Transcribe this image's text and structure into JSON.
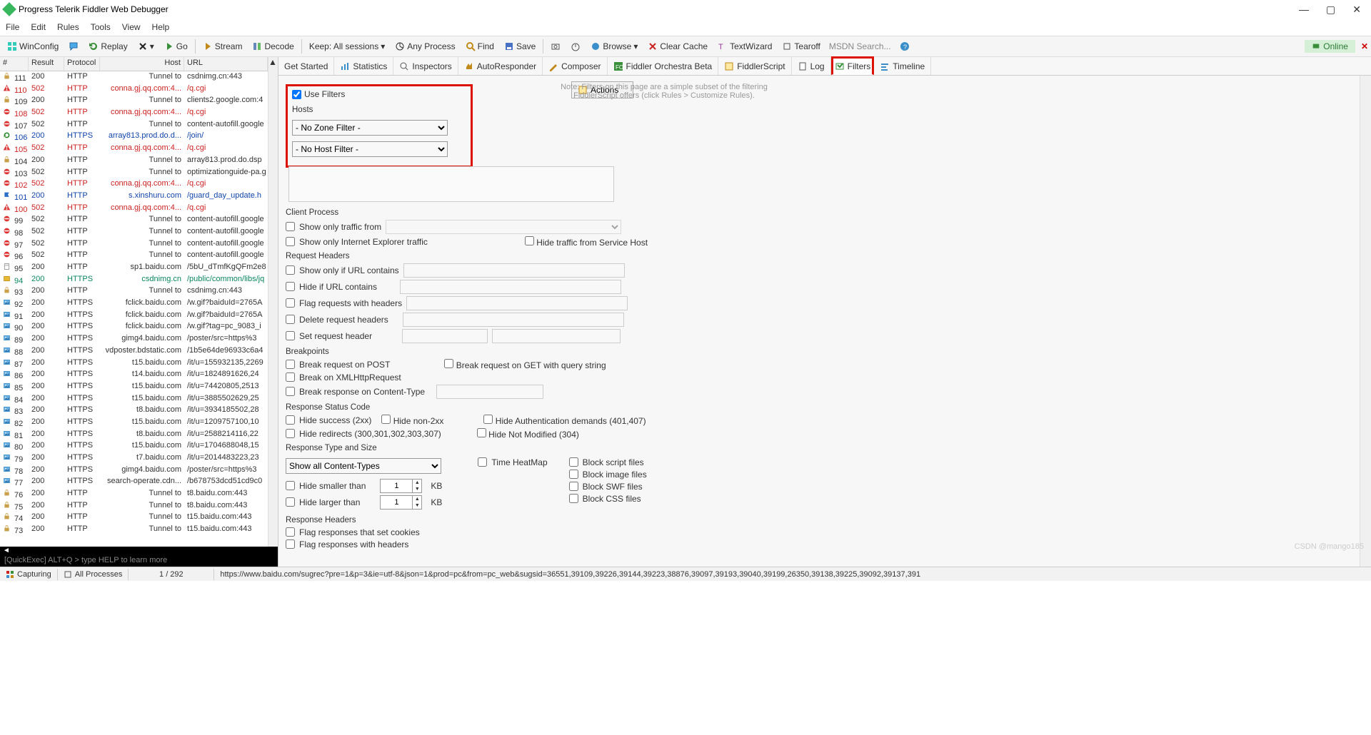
{
  "titlebar": {
    "title": "Progress Telerik Fiddler Web Debugger"
  },
  "menubar": {
    "items": [
      "File",
      "Edit",
      "Rules",
      "Tools",
      "View",
      "Help"
    ]
  },
  "toolbar": {
    "winconfig": "WinConfig",
    "replay": "Replay",
    "go": "Go",
    "stream": "Stream",
    "decode": "Decode",
    "keep": "Keep: All sessions",
    "anyprocess": "Any Process",
    "find": "Find",
    "save": "Save",
    "browse": "Browse",
    "clear": "Clear Cache",
    "textwizard": "TextWizard",
    "tearoff": "Tearoff",
    "search_placeholder": "MSDN Search...",
    "online": "Online"
  },
  "left": {
    "headers": {
      "num": "#",
      "result": "Result",
      "protocol": "Protocol",
      "host": "Host",
      "url": "URL"
    },
    "quickexec": "[QuickExec] ALT+Q > type HELP to learn more",
    "rows": [
      {
        "n": "111",
        "r": "200",
        "p": "HTTP",
        "h": "Tunnel to",
        "u": "csdnimg.cn:443",
        "cls": "row-black",
        "ico": "lock"
      },
      {
        "n": "110",
        "r": "502",
        "p": "HTTP",
        "h": "conna.gj.qq.com:4...",
        "u": "/q.cgi",
        "cls": "row-red",
        "ico": "warn"
      },
      {
        "n": "109",
        "r": "200",
        "p": "HTTP",
        "h": "Tunnel to",
        "u": "clients2.google.com:4",
        "cls": "row-black",
        "ico": "lock"
      },
      {
        "n": "108",
        "r": "502",
        "p": "HTTP",
        "h": "conna.gj.qq.com:4...",
        "u": "/q.cgi",
        "cls": "row-red",
        "ico": "block"
      },
      {
        "n": "107",
        "r": "502",
        "p": "HTTP",
        "h": "Tunnel to",
        "u": "content-autofill.google",
        "cls": "row-black",
        "ico": "block"
      },
      {
        "n": "106",
        "r": "200",
        "p": "HTTPS",
        "h": "array813.prod.do.d...",
        "u": "/join/",
        "cls": "row-blue",
        "ico": "refresh"
      },
      {
        "n": "105",
        "r": "502",
        "p": "HTTP",
        "h": "conna.gj.qq.com:4...",
        "u": "/q.cgi",
        "cls": "row-red",
        "ico": "warn"
      },
      {
        "n": "104",
        "r": "200",
        "p": "HTTP",
        "h": "Tunnel to",
        "u": "array813.prod.do.dsp",
        "cls": "row-black",
        "ico": "lock"
      },
      {
        "n": "103",
        "r": "502",
        "p": "HTTP",
        "h": "Tunnel to",
        "u": "optimizationguide-pa.g",
        "cls": "row-black",
        "ico": "block"
      },
      {
        "n": "102",
        "r": "502",
        "p": "HTTP",
        "h": "conna.gj.qq.com:4...",
        "u": "/q.cgi",
        "cls": "row-red",
        "ico": "block"
      },
      {
        "n": "101",
        "r": "200",
        "p": "HTTP",
        "h": "s.xinshuru.com",
        "u": "/guard_day_update.h",
        "cls": "row-blue",
        "ico": "blue"
      },
      {
        "n": "100",
        "r": "502",
        "p": "HTTP",
        "h": "conna.gj.qq.com:4...",
        "u": "/q.cgi",
        "cls": "row-red",
        "ico": "warn"
      },
      {
        "n": "99",
        "r": "502",
        "p": "HTTP",
        "h": "Tunnel to",
        "u": "content-autofill.google",
        "cls": "row-black",
        "ico": "block"
      },
      {
        "n": "98",
        "r": "502",
        "p": "HTTP",
        "h": "Tunnel to",
        "u": "content-autofill.google",
        "cls": "row-black",
        "ico": "block"
      },
      {
        "n": "97",
        "r": "502",
        "p": "HTTP",
        "h": "Tunnel to",
        "u": "content-autofill.google",
        "cls": "row-black",
        "ico": "block"
      },
      {
        "n": "96",
        "r": "502",
        "p": "HTTP",
        "h": "Tunnel to",
        "u": "content-autofill.google",
        "cls": "row-black",
        "ico": "block"
      },
      {
        "n": "95",
        "r": "200",
        "p": "HTTP",
        "h": "sp1.baidu.com",
        "u": "/5bU_dTmfKgQFm2e8",
        "cls": "row-black",
        "ico": "page"
      },
      {
        "n": "94",
        "r": "200",
        "p": "HTTPS",
        "h": "csdnimg.cn",
        "u": "/public/common/libs/jq",
        "cls": "row-teal",
        "ico": "green"
      },
      {
        "n": "93",
        "r": "200",
        "p": "HTTP",
        "h": "Tunnel to",
        "u": "csdnimg.cn:443",
        "cls": "row-black",
        "ico": "lock"
      },
      {
        "n": "92",
        "r": "200",
        "p": "HTTPS",
        "h": "fclick.baidu.com",
        "u": "/w.gif?baiduId=2765A",
        "cls": "row-black",
        "ico": "img"
      },
      {
        "n": "91",
        "r": "200",
        "p": "HTTPS",
        "h": "fclick.baidu.com",
        "u": "/w.gif?baiduId=2765A",
        "cls": "row-black",
        "ico": "img"
      },
      {
        "n": "90",
        "r": "200",
        "p": "HTTPS",
        "h": "fclick.baidu.com",
        "u": "/w.gif?tag=pc_9083_i",
        "cls": "row-black",
        "ico": "img"
      },
      {
        "n": "89",
        "r": "200",
        "p": "HTTPS",
        "h": "gimg4.baidu.com",
        "u": "/poster/src=https%3",
        "cls": "row-black",
        "ico": "img"
      },
      {
        "n": "88",
        "r": "200",
        "p": "HTTPS",
        "h": "vdposter.bdstatic.com",
        "u": "/1b5e64de96933c6a4",
        "cls": "row-black",
        "ico": "img"
      },
      {
        "n": "87",
        "r": "200",
        "p": "HTTPS",
        "h": "t15.baidu.com",
        "u": "/it/u=155932135,2269",
        "cls": "row-black",
        "ico": "img"
      },
      {
        "n": "86",
        "r": "200",
        "p": "HTTPS",
        "h": "t14.baidu.com",
        "u": "/it/u=1824891626,24",
        "cls": "row-black",
        "ico": "img"
      },
      {
        "n": "85",
        "r": "200",
        "p": "HTTPS",
        "h": "t15.baidu.com",
        "u": "/it/u=74420805,2513",
        "cls": "row-black",
        "ico": "img"
      },
      {
        "n": "84",
        "r": "200",
        "p": "HTTPS",
        "h": "t15.baidu.com",
        "u": "/it/u=3885502629,25",
        "cls": "row-black",
        "ico": "img"
      },
      {
        "n": "83",
        "r": "200",
        "p": "HTTPS",
        "h": "t8.baidu.com",
        "u": "/it/u=3934185502,28",
        "cls": "row-black",
        "ico": "img"
      },
      {
        "n": "82",
        "r": "200",
        "p": "HTTPS",
        "h": "t15.baidu.com",
        "u": "/it/u=1209757100,10",
        "cls": "row-black",
        "ico": "img"
      },
      {
        "n": "81",
        "r": "200",
        "p": "HTTPS",
        "h": "t8.baidu.com",
        "u": "/it/u=2588214116,22",
        "cls": "row-black",
        "ico": "img"
      },
      {
        "n": "80",
        "r": "200",
        "p": "HTTPS",
        "h": "t15.baidu.com",
        "u": "/it/u=1704688048,15",
        "cls": "row-black",
        "ico": "img"
      },
      {
        "n": "79",
        "r": "200",
        "p": "HTTPS",
        "h": "t7.baidu.com",
        "u": "/it/u=2014483223,23",
        "cls": "row-black",
        "ico": "img"
      },
      {
        "n": "78",
        "r": "200",
        "p": "HTTPS",
        "h": "gimg4.baidu.com",
        "u": "/poster/src=https%3",
        "cls": "row-black",
        "ico": "img"
      },
      {
        "n": "77",
        "r": "200",
        "p": "HTTPS",
        "h": "search-operate.cdn...",
        "u": "/b678753dcd51cd9c0",
        "cls": "row-black",
        "ico": "img"
      },
      {
        "n": "76",
        "r": "200",
        "p": "HTTP",
        "h": "Tunnel to",
        "u": "t8.baidu.com:443",
        "cls": "row-black",
        "ico": "lock"
      },
      {
        "n": "75",
        "r": "200",
        "p": "HTTP",
        "h": "Tunnel to",
        "u": "t8.baidu.com:443",
        "cls": "row-black",
        "ico": "lock"
      },
      {
        "n": "74",
        "r": "200",
        "p": "HTTP",
        "h": "Tunnel to",
        "u": "t15.baidu.com:443",
        "cls": "row-black",
        "ico": "lock"
      },
      {
        "n": "73",
        "r": "200",
        "p": "HTTP",
        "h": "Tunnel to",
        "u": "t15.baidu.com:443",
        "cls": "row-black",
        "ico": "lock"
      }
    ]
  },
  "tabs": {
    "items": [
      "Get Started",
      "Statistics",
      "Inspectors",
      "AutoResponder",
      "Composer",
      "Fiddler Orchestra Beta",
      "FiddlerScript",
      "Log",
      "Filters",
      "Timeline"
    ],
    "active": 8
  },
  "filters": {
    "use_filters": "Use Filters",
    "note": "Note: Filters on this page are a simple subset of the filtering FiddlerScript offers (click Rules > Customize Rules).",
    "actions": "Actions",
    "hosts_title": "Hosts",
    "zone_filter": "- No Zone Filter -",
    "host_filter": "- No Host Filter -",
    "client_process": {
      "title": "Client Process",
      "show_only": "Show only traffic from",
      "ie_only": "Show only Internet Explorer traffic",
      "hide_svc": "Hide traffic from Service Host"
    },
    "req_headers": {
      "title": "Request Headers",
      "url_contains": "Show only if URL contains",
      "url_hide": "Hide if URL contains",
      "flag_hdr": "Flag requests with headers",
      "del_hdr": "Delete request headers",
      "set_hdr": "Set request header"
    },
    "breakpoints": {
      "title": "Breakpoints",
      "post": "Break request on POST",
      "get": "Break request on GET with query string",
      "xhr": "Break on XMLHttpRequest",
      "ct": "Break response on Content-Type"
    },
    "status": {
      "title": "Response Status Code",
      "s2": "Hide success (2xx)",
      "n2": "Hide non-2xx",
      "auth": "Hide Authentication demands (401,407)",
      "redir": "Hide redirects (300,301,302,303,307)",
      "nm": "Hide Not Modified (304)"
    },
    "type_size": {
      "title": "Response Type and Size",
      "ct": "Show all Content-Types",
      "hm": "Time HeatMap",
      "script": "Block script files",
      "img": "Block image files",
      "swf": "Block SWF files",
      "css": "Block CSS files",
      "smaller": "Hide smaller than",
      "larger": "Hide larger than",
      "val1": "1",
      "val2": "1",
      "kb": "KB"
    },
    "resp_headers": {
      "title": "Response Headers",
      "cookies": "Flag responses that set cookies",
      "hdr": "Flag responses with headers"
    }
  },
  "statusbar": {
    "capturing": "Capturing",
    "allproc": "All Processes",
    "count": "1 / 292",
    "url": "https://www.baidu.com/sugrec?pre=1&p=3&ie=utf-8&json=1&prod=pc&from=pc_web&sugsid=36551,39109,39226,39144,39223,38876,39097,39193,39040,39199,26350,39138,39225,39092,39137,391",
    "watermark": "CSDN @mango185"
  }
}
